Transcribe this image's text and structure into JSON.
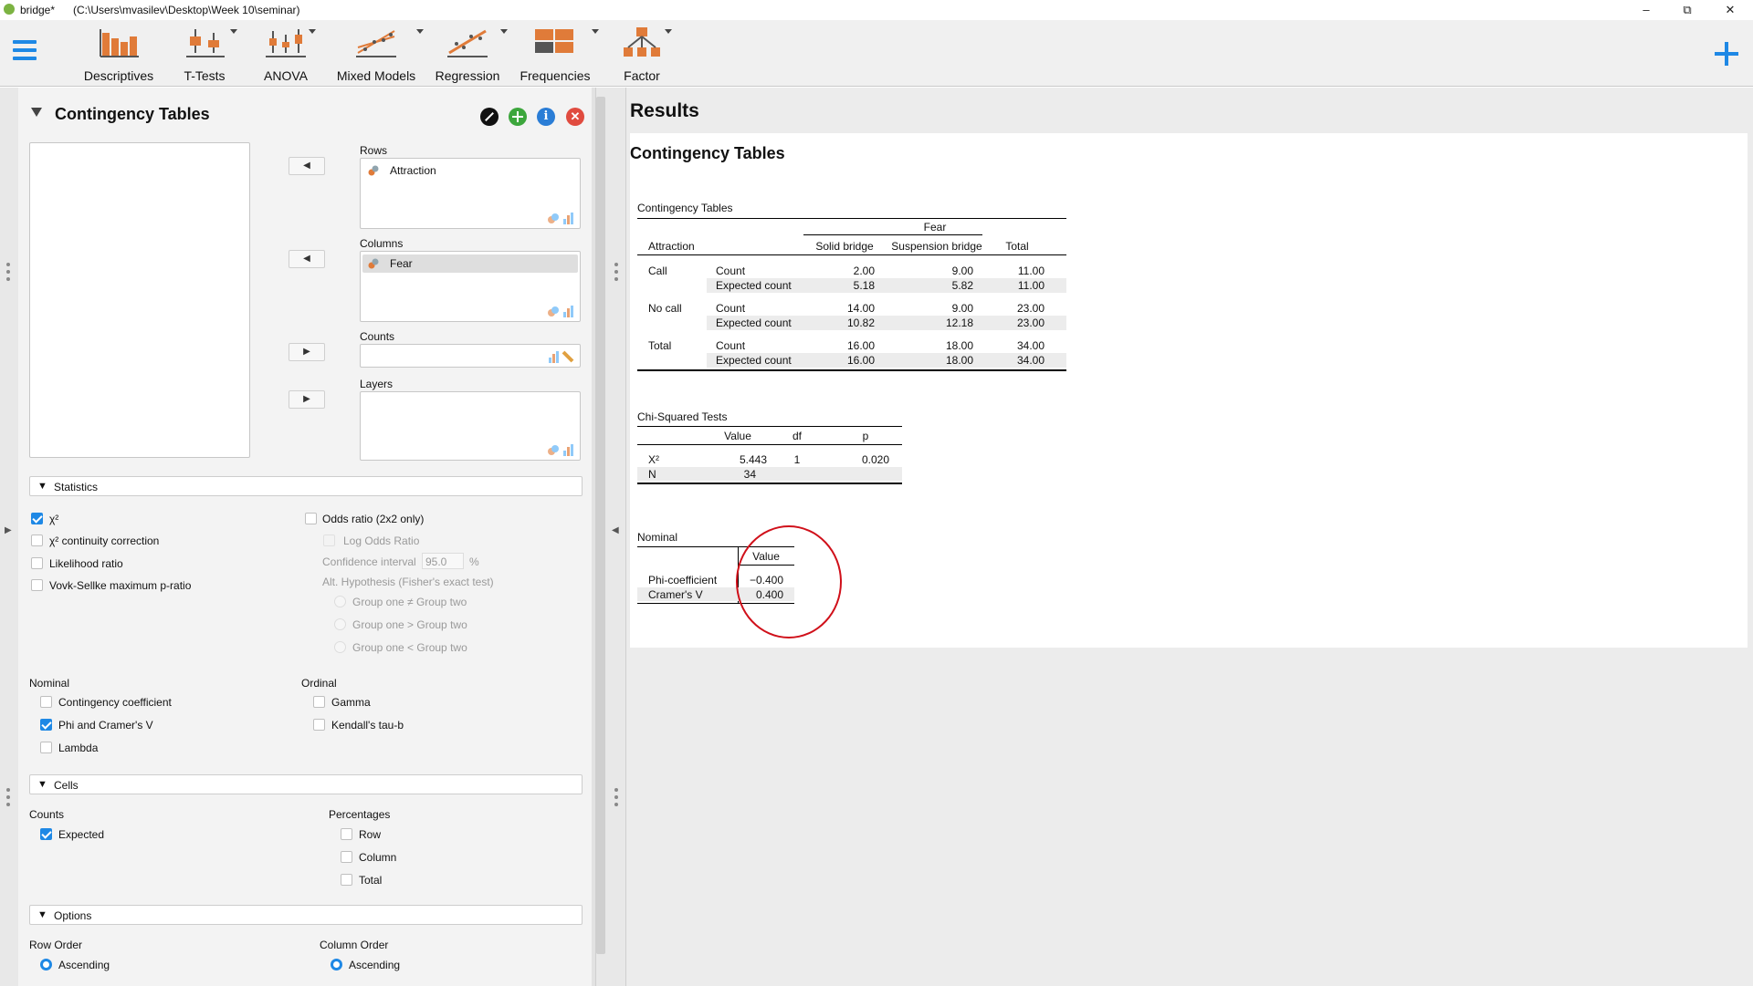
{
  "window": {
    "app_name": "bridge*",
    "path": "(C:\\Users\\mvasilev\\Desktop\\Week 10\\seminar)"
  },
  "ribbon": {
    "items": [
      {
        "label": "Descriptives"
      },
      {
        "label": "T-Tests"
      },
      {
        "label": "ANOVA"
      },
      {
        "label": "Mixed Models"
      },
      {
        "label": "Regression"
      },
      {
        "label": "Frequencies"
      },
      {
        "label": "Factor"
      }
    ]
  },
  "analysis": {
    "title": "Contingency Tables",
    "rows_label": "Rows",
    "rows_var": "Attraction",
    "columns_label": "Columns",
    "columns_var": "Fear",
    "counts_label": "Counts",
    "layers_label": "Layers",
    "statistics": {
      "header": "Statistics",
      "chi2": "χ²",
      "chi2_cc": "χ² continuity correction",
      "likelihood": "Likelihood ratio",
      "vovk": "Vovk-Sellke maximum p-ratio",
      "odds": "Odds ratio (2x2 only)",
      "log_odds": "Log Odds Ratio",
      "ci_label": "Confidence interval",
      "ci_value": "95.0",
      "ci_unit": "%",
      "alt_hyp": "Alt. Hypothesis (Fisher's exact test)",
      "g1": "Group one ≠ Group two",
      "g2": "Group one > Group two",
      "g3": "Group one < Group two",
      "nominal": "Nominal",
      "contingency": "Contingency coefficient",
      "phi": "Phi and Cramer's V",
      "lambda": "Lambda",
      "ordinal": "Ordinal",
      "gamma": "Gamma",
      "kendall": "Kendall's tau-b"
    },
    "cells": {
      "header": "Cells",
      "counts": "Counts",
      "expected": "Expected",
      "percentages": "Percentages",
      "row": "Row",
      "column": "Column",
      "total": "Total"
    },
    "options": {
      "header": "Options",
      "row_order": "Row Order",
      "row_asc": "Ascending",
      "col_order": "Column Order",
      "col_asc": "Ascending"
    }
  },
  "results": {
    "title": "Results",
    "section": "Contingency Tables",
    "ct": {
      "caption": "Contingency Tables",
      "group": "Fear",
      "row_var": "Attraction",
      "cols": [
        "Solid bridge",
        "Suspension bridge",
        "Total"
      ],
      "rows": [
        {
          "g": "Call",
          "l1": "Count",
          "v1": [
            "2.00",
            "9.00",
            "11.00"
          ],
          "l2": "Expected count",
          "v2": [
            "5.18",
            "5.82",
            "11.00"
          ]
        },
        {
          "g": "No call",
          "l1": "Count",
          "v1": [
            "14.00",
            "9.00",
            "23.00"
          ],
          "l2": "Expected count",
          "v2": [
            "10.82",
            "12.18",
            "23.00"
          ]
        },
        {
          "g": "Total",
          "l1": "Count",
          "v1": [
            "16.00",
            "18.00",
            "34.00"
          ],
          "l2": "Expected count",
          "v2": [
            "16.00",
            "18.00",
            "34.00"
          ]
        }
      ]
    },
    "chi": {
      "caption": "Chi-Squared Tests",
      "h_value": "Value",
      "h_df": "df",
      "h_p": "p",
      "r1_label": "Χ²",
      "r1_value": "5.443",
      "r1_df": "1",
      "r1_p": "0.020",
      "r2_label": "N",
      "r2_value": "34"
    },
    "nominal": {
      "caption": "Nominal",
      "h_value": "Value",
      "r1_label": "Phi-coefficient",
      "r1_value": "−0.400",
      "r2_label": "Cramer's V",
      "r2_value": "0.400"
    }
  },
  "colors": {
    "accent": "#1e88e5",
    "annotation_circle": "#d0101a",
    "edit": "#111111",
    "add": "#3ca63c",
    "info": "#2a7dd6",
    "close": "#e04b3f"
  }
}
